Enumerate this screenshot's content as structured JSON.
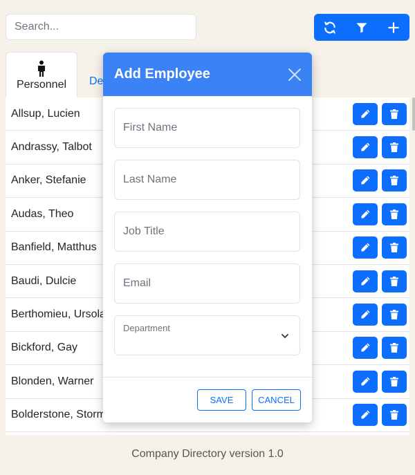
{
  "search": {
    "placeholder": "Search..."
  },
  "toolbar": {
    "refresh_icon": "refresh-icon",
    "filter_icon": "filter-icon",
    "add_icon": "plus-icon"
  },
  "tabs": [
    {
      "label": "Personnel",
      "icon": "person-icon",
      "active": true
    },
    {
      "label": "De",
      "active": false
    }
  ],
  "personnel": [
    "Allsup, Lucien",
    "Andrassy, Talbot",
    "Anker, Stefanie",
    "Audas, Theo",
    "Banfield, Matthus",
    "Baudi, Dulcie",
    "Berthomieu, Ursola",
    "Bickford, Gay",
    "Blonden, Warner",
    "Bolderstone, Storm"
  ],
  "modal": {
    "title": "Add Employee",
    "fields": {
      "first_name": "First Name",
      "last_name": "Last Name",
      "job_title": "Job Title",
      "email": "Email",
      "department": "Department"
    },
    "save_label": "SAVE",
    "cancel_label": "CANCEL"
  },
  "footer": {
    "text": "Company Directory version 1.0"
  },
  "colors": {
    "primary": "#0d6efd",
    "header": "#3b82f6",
    "background": "#f6f2ea"
  }
}
